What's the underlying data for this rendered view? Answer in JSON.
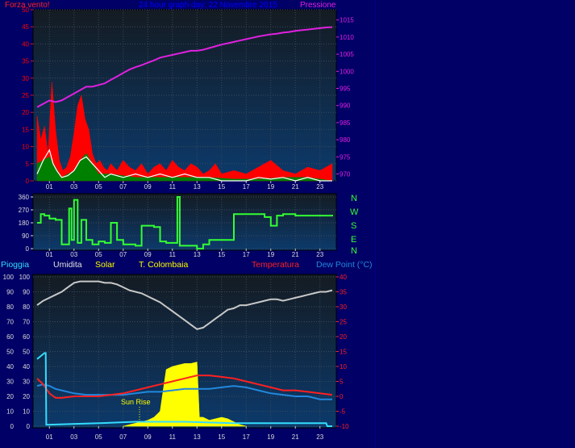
{
  "colors": {
    "background": "#000066",
    "plot_top": "#101820",
    "plot_bottom": "#0b3a6a",
    "wind_gust": "#ff0000",
    "wind_avg": "#008000",
    "wind_line": "#ffffff",
    "pressure": "#e020e0",
    "direction": "#33ff33",
    "rain": "#33ddff",
    "humidity": "#c8c8c8",
    "solar": "#ffff00",
    "temperature": "#ff2020",
    "dew_point": "#2288dd",
    "title": "#0000ff"
  },
  "header": {
    "left_label": "Forza vento!",
    "title": "24 hour graph day:  22 Novembre 2015",
    "right_label": "Pressione"
  },
  "direction_labels": [
    "N",
    "W",
    "S",
    "E",
    "N"
  ],
  "bottom_header": {
    "rain": "Pioggia",
    "humidity": "Umidita",
    "solar": "Solar",
    "station": "T. Colombaia",
    "temperature": "Temperatura",
    "dew_point": "Dew Point (°C)"
  },
  "annotation": "Sun Rise",
  "chart_data": [
    {
      "type": "line",
      "title": "24 hour graph day:  22 Novembre 2015",
      "x_ticks": [
        "01",
        "03",
        "05",
        "07",
        "09",
        "11",
        "13",
        "15",
        "17",
        "19",
        "21",
        "23"
      ],
      "xlim": [
        0,
        24
      ],
      "left_axis": {
        "label": "Forza vento!",
        "ylim": [
          0,
          50
        ],
        "ticks": [
          0,
          5,
          10,
          15,
          20,
          25,
          30,
          35,
          40,
          45,
          50
        ]
      },
      "right_axis": {
        "label": "Pressione",
        "ylim": [
          968,
          1018
        ],
        "ticks": [
          970,
          975,
          980,
          985,
          990,
          995,
          1000,
          1005,
          1010,
          1015
        ]
      },
      "series": [
        {
          "name": "Pressione",
          "axis": "right",
          "x": [
            0,
            0.5,
            1,
            1.5,
            2,
            2.5,
            3,
            3.5,
            4,
            4.5,
            5,
            5.5,
            6,
            6.5,
            7,
            7.5,
            8,
            8.5,
            9,
            9.5,
            10,
            10.5,
            11,
            11.5,
            12,
            12.5,
            13,
            13.5,
            14,
            14.5,
            15,
            15.5,
            16,
            16.5,
            17,
            17.5,
            18,
            18.5,
            19,
            19.5,
            20,
            20.5,
            21,
            21.5,
            22,
            22.5,
            23,
            23.5,
            24
          ],
          "values": [
            989.5,
            990.5,
            991.5,
            991,
            991.5,
            992.5,
            993.5,
            994.5,
            995.5,
            995.5,
            996,
            996.5,
            997.5,
            998.5,
            999.5,
            1000.5,
            1001.2,
            1001.8,
            1002.5,
            1003.2,
            1004,
            1004.4,
            1004.8,
            1005.2,
            1005.6,
            1006,
            1006,
            1006.3,
            1006.8,
            1007.3,
            1007.8,
            1008.2,
            1008.6,
            1009,
            1009.4,
            1009.8,
            1010.2,
            1010.5,
            1010.8,
            1011,
            1011.3,
            1011.5,
            1011.8,
            1012,
            1012.2,
            1012.4,
            1012.6,
            1012.8,
            1012.9
          ]
        },
        {
          "name": "wind_gust",
          "axis": "left",
          "x": [
            0,
            0.3,
            0.6,
            0.9,
            1.2,
            1.5,
            1.8,
            2.1,
            2.4,
            2.7,
            3,
            3.3,
            3.6,
            3.9,
            4.2,
            4.5,
            4.8,
            5.1,
            5.4,
            5.7,
            6,
            6.5,
            7,
            7.5,
            8,
            8.5,
            9,
            9.5,
            10,
            10.5,
            11,
            11.5,
            12,
            12.5,
            13,
            13.5,
            14,
            14.5,
            15,
            16,
            17,
            18,
            19,
            20,
            21,
            22,
            23,
            24
          ],
          "values": [
            19,
            12,
            16,
            8,
            29,
            15,
            6,
            3,
            4,
            7,
            14,
            22,
            25,
            18,
            15,
            8,
            5,
            6,
            4,
            3,
            5,
            3,
            6,
            4,
            3,
            5,
            2,
            4,
            5,
            3,
            6,
            4,
            3,
            5,
            4,
            2,
            3,
            5,
            2,
            3,
            2,
            4,
            6,
            3,
            2,
            4,
            3,
            5
          ]
        },
        {
          "name": "wind_avg",
          "axis": "left",
          "x": [
            0,
            1,
            1.5,
            2,
            3,
            3.5,
            4,
            4.5,
            5,
            6,
            8,
            10,
            12,
            14,
            16,
            18,
            20,
            22,
            24
          ],
          "values": [
            5,
            7,
            4,
            1,
            3,
            6,
            8,
            5,
            2,
            2,
            1,
            1,
            1,
            1,
            0.5,
            0.5,
            1,
            1,
            0
          ]
        },
        {
          "name": "wind_line",
          "axis": "left",
          "x": [
            0,
            0.5,
            1,
            1.3,
            1.6,
            2,
            2.5,
            3,
            3.5,
            4,
            4.5,
            5,
            5.5,
            6,
            7,
            8,
            9,
            10,
            11,
            12,
            13,
            14,
            15,
            16,
            17,
            18,
            19,
            20,
            21,
            22,
            23,
            24
          ],
          "values": [
            2,
            6,
            9,
            5,
            3,
            1,
            1.5,
            3,
            6,
            7,
            5,
            3,
            1,
            2,
            1,
            2,
            1,
            2,
            1,
            2,
            1,
            1,
            0,
            0,
            0,
            1,
            0.5,
            1,
            0,
            1,
            0,
            0
          ]
        }
      ]
    },
    {
      "type": "line",
      "x_ticks": [
        "01",
        "03",
        "05",
        "07",
        "09",
        "11",
        "13",
        "15",
        "17",
        "19",
        "21",
        "23"
      ],
      "xlim": [
        0,
        24
      ],
      "ylim": [
        0,
        360
      ],
      "y_ticks": [
        0,
        90,
        180,
        270,
        360
      ],
      "series": [
        {
          "name": "direction",
          "x": [
            0,
            0.3,
            0.6,
            1,
            1.5,
            2,
            2.6,
            2.8,
            3,
            3.3,
            3.6,
            4,
            4.5,
            5,
            5.5,
            6,
            6.5,
            7,
            7.5,
            8,
            8.5,
            9,
            9.5,
            10,
            10.5,
            11,
            11.4,
            11.6,
            12,
            12.5,
            13,
            13.5,
            14,
            14.5,
            15,
            15.5,
            16,
            17,
            18,
            18.5,
            19,
            19.5,
            20,
            21,
            22,
            23,
            24
          ],
          "values": [
            180,
            240,
            230,
            210,
            200,
            30,
            280,
            60,
            340,
            40,
            200,
            60,
            30,
            50,
            40,
            180,
            60,
            30,
            30,
            20,
            160,
            160,
            150,
            50,
            40,
            40,
            360,
            20,
            20,
            20,
            0,
            30,
            60,
            60,
            60,
            60,
            240,
            240,
            240,
            220,
            160,
            230,
            240,
            230,
            230,
            230,
            225
          ]
        }
      ]
    },
    {
      "type": "line",
      "x_ticks": [
        "01",
        "03",
        "05",
        "07",
        "09",
        "11",
        "13",
        "15",
        "17",
        "19",
        "21",
        "23"
      ],
      "xlim": [
        0,
        24
      ],
      "left_axis": {
        "ylim": [
          0,
          100
        ],
        "ticks": [
          0,
          10,
          20,
          30,
          40,
          50,
          60,
          70,
          80,
          90,
          100
        ]
      },
      "right_axis": {
        "ylim": [
          -10,
          40
        ],
        "ticks": [
          -10,
          -5,
          0,
          5,
          10,
          15,
          20,
          25,
          30,
          35,
          40
        ]
      },
      "series": [
        {
          "name": "Umidita",
          "axis": "left",
          "x": [
            0,
            0.5,
            1,
            1.5,
            2,
            2.5,
            3,
            3.5,
            4,
            4.5,
            5,
            5.5,
            6,
            6.5,
            7,
            7.5,
            8,
            8.5,
            9,
            9.5,
            10,
            10.5,
            11,
            11.5,
            12,
            12.5,
            13,
            13.5,
            14,
            14.5,
            15,
            15.5,
            16,
            16.5,
            17,
            17.5,
            18,
            18.5,
            19,
            19.5,
            20,
            20.5,
            21,
            21.5,
            22,
            22.5,
            23,
            23.5,
            24
          ],
          "values": [
            81,
            84,
            86,
            88,
            90,
            93,
            96,
            97,
            97,
            97,
            97,
            96,
            96,
            95,
            93,
            91,
            90,
            89,
            87,
            85,
            83,
            80,
            77,
            74,
            71,
            68,
            65,
            66,
            69,
            72,
            75,
            78,
            79,
            81,
            81,
            82,
            83,
            84,
            85,
            85,
            84,
            85,
            86,
            87,
            88,
            89,
            90,
            90,
            91
          ]
        },
        {
          "name": "Pioggia",
          "axis": "left",
          "x": [
            0,
            0.3,
            0.6,
            0.7,
            0.75,
            1,
            5,
            8,
            12,
            16,
            20,
            23.5,
            23.6,
            24
          ],
          "values": [
            45,
            47,
            49,
            49,
            1,
            1,
            2,
            3,
            3,
            2,
            2,
            2,
            0,
            0
          ]
        },
        {
          "name": "Solar",
          "axis": "left",
          "x": [
            7,
            7.5,
            8,
            8.5,
            9,
            9.5,
            10,
            10.5,
            11,
            11.5,
            12,
            12.5,
            13,
            13.2,
            13.5,
            14,
            14.5,
            15,
            15.5,
            16,
            16.5,
            17
          ],
          "values": [
            0,
            1,
            2,
            3,
            4,
            6,
            10,
            38,
            40,
            41,
            42,
            42,
            43,
            6,
            6,
            4,
            5,
            6,
            5,
            3,
            1,
            0
          ]
        },
        {
          "name": "Temperatura",
          "axis": "right",
          "x": [
            0,
            0.5,
            1,
            1.5,
            2,
            3,
            4,
            5,
            6,
            7,
            8,
            9,
            10,
            11,
            12,
            13,
            14,
            15,
            16,
            17,
            18,
            19,
            20,
            21,
            22,
            23,
            24
          ],
          "values": [
            6,
            4,
            1,
            -0.5,
            -0.5,
            0,
            0,
            0,
            0.5,
            1,
            2,
            3,
            4,
            5,
            6,
            7,
            7,
            6.5,
            6,
            5,
            4,
            3,
            2,
            2,
            1.5,
            1,
            0.5
          ]
        },
        {
          "name": "Dew Point (°C)",
          "axis": "right",
          "x": [
            0,
            0.5,
            1,
            1.5,
            2,
            3,
            4,
            5,
            6,
            7,
            8,
            9,
            10,
            11,
            12,
            13,
            14,
            15,
            16,
            17,
            18,
            19,
            20,
            21,
            22,
            23,
            24
          ],
          "values": [
            3.5,
            4,
            3.5,
            2.5,
            2,
            1,
            0.5,
            0.5,
            0.5,
            0.5,
            1,
            1.5,
            1.5,
            2,
            2.5,
            2.5,
            2.5,
            3,
            3.5,
            3,
            2,
            1,
            0.5,
            0,
            0,
            -1,
            -1
          ]
        }
      ]
    }
  ]
}
